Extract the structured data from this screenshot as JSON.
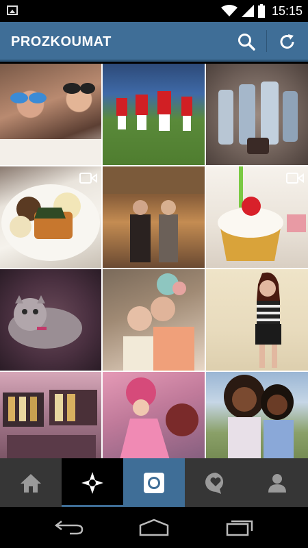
{
  "status_bar": {
    "time": "15:15"
  },
  "header": {
    "title": "PROZKOUMAT"
  },
  "grid": {
    "items": [
      {
        "kind": "photo"
      },
      {
        "kind": "photo"
      },
      {
        "kind": "photo"
      },
      {
        "kind": "video"
      },
      {
        "kind": "photo"
      },
      {
        "kind": "video"
      },
      {
        "kind": "photo"
      },
      {
        "kind": "photo"
      },
      {
        "kind": "photo"
      },
      {
        "kind": "photo"
      },
      {
        "kind": "photo"
      },
      {
        "kind": "photo"
      }
    ]
  },
  "tabs": [
    {
      "icon": "home-icon"
    },
    {
      "icon": "explore-icon",
      "selected": true
    },
    {
      "icon": "camera-icon"
    },
    {
      "icon": "activity-icon"
    },
    {
      "icon": "profile-icon"
    }
  ],
  "colors": {
    "header": "#3f6e97",
    "tabbar": "#363636",
    "selected_tab": "#000000"
  }
}
